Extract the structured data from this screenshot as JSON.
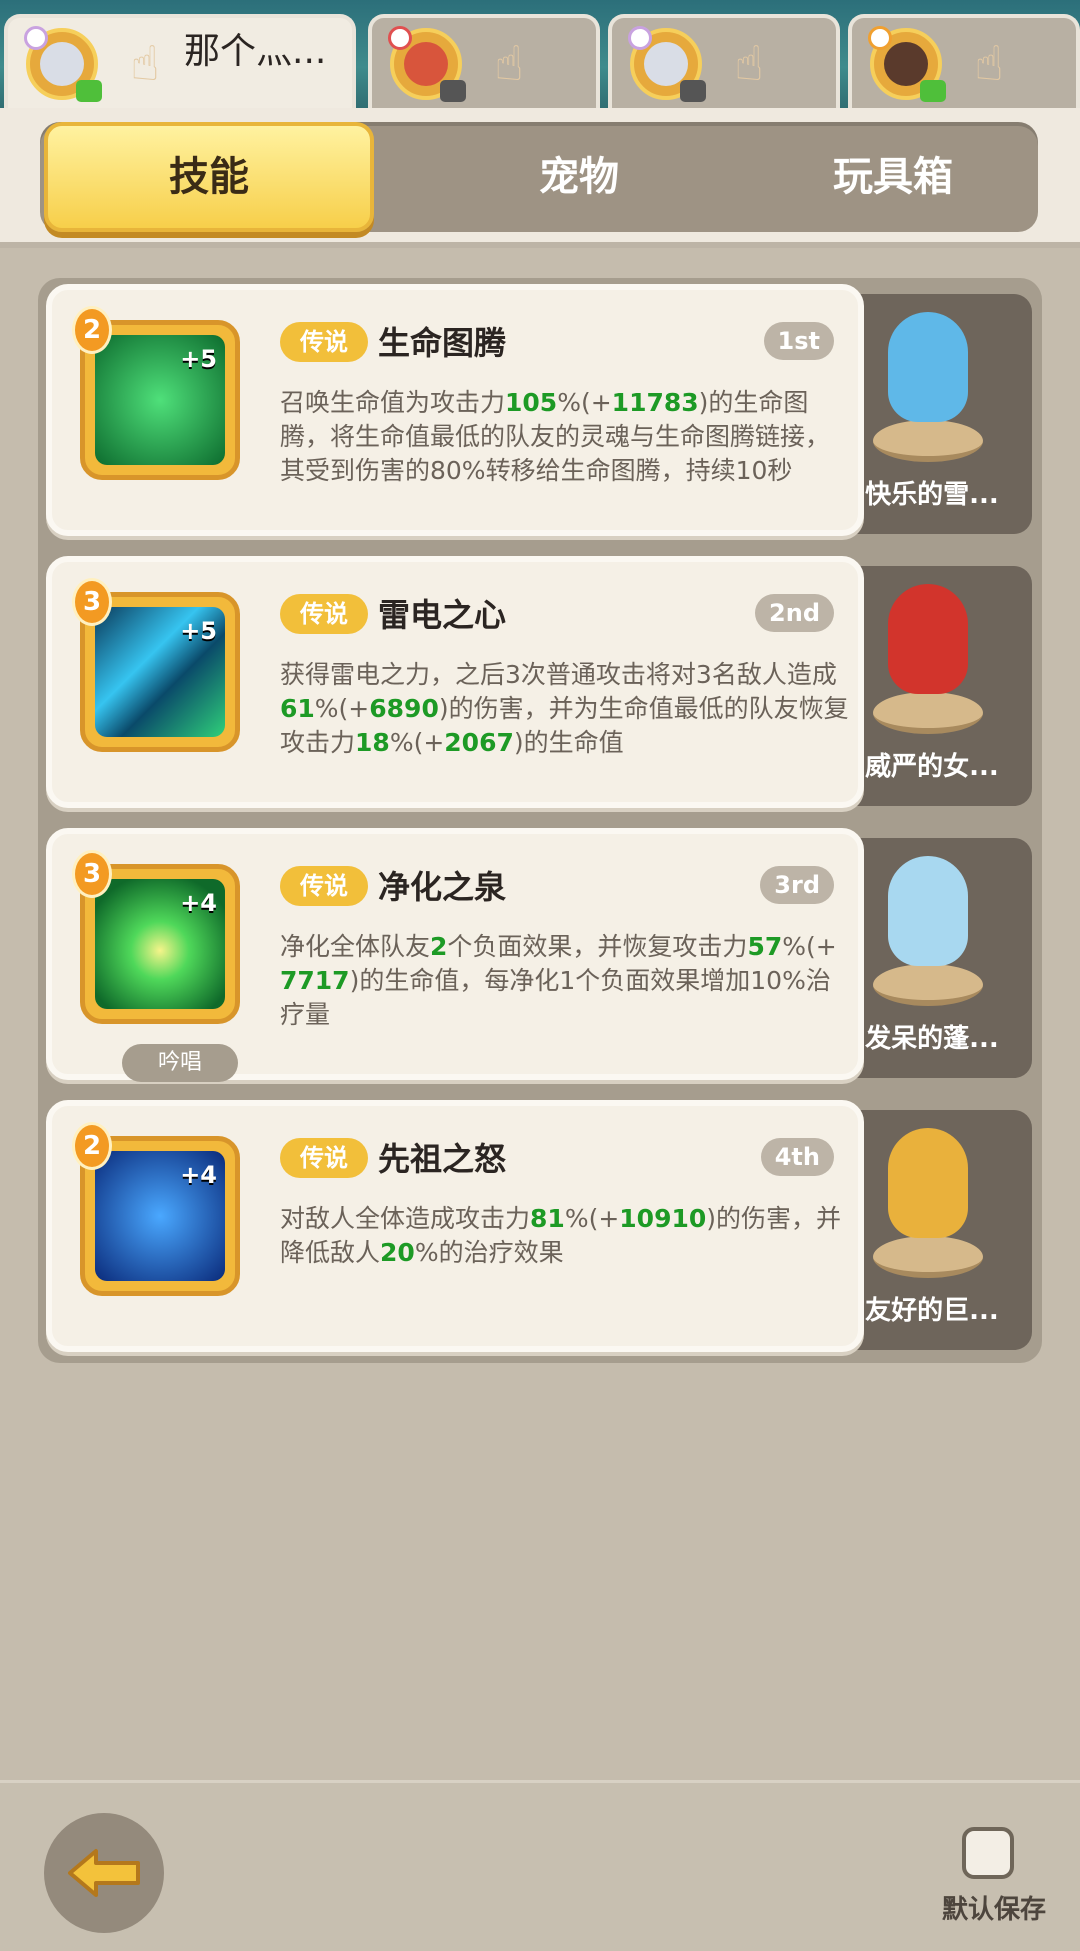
{
  "hero_tabs": [
    {
      "name": "那个灬...",
      "active": true
    },
    {
      "name": "",
      "active": false
    },
    {
      "name": "",
      "active": false
    },
    {
      "name": "",
      "active": false
    }
  ],
  "tabs": [
    {
      "label": "技能",
      "active": true
    },
    {
      "label": "宠物",
      "active": false
    },
    {
      "label": "玩具箱",
      "active": false
    }
  ],
  "skills": [
    {
      "level": "2",
      "bonus": "+5",
      "rarity": "传说",
      "name": "生命图腾",
      "rank": "1st",
      "desc_parts": [
        "召唤生命值为攻击力",
        "105",
        "%(+",
        "11783",
        ")的生命图腾，将生命值最低的队友的灵魂与生命图腾链接，其受到伤害的80%转移给生命图腾，持续10秒"
      ],
      "chant": "",
      "pet_name": "快乐的雪..."
    },
    {
      "level": "3",
      "bonus": "+5",
      "rarity": "传说",
      "name": "雷电之心",
      "rank": "2nd",
      "desc_parts": [
        "获得雷电之力，之后3次普通攻击将对3名敌人造成",
        "61",
        "%(+",
        "6890",
        ")的伤害，并为生命值最低的队友恢复攻击力",
        "18",
        "%(+",
        "2067",
        ")的生命值"
      ],
      "chant": "",
      "pet_name": "威严的女..."
    },
    {
      "level": "3",
      "bonus": "+4",
      "rarity": "传说",
      "name": "净化之泉",
      "rank": "3rd",
      "desc_parts": [
        "净化全体队友",
        "2",
        "个负面效果，并恢复攻击力",
        "57",
        "%(+",
        "7717",
        ")的生命值，每净化1个负面效果增加10%治疗量"
      ],
      "chant": "吟唱",
      "pet_name": "发呆的蓬..."
    },
    {
      "level": "2",
      "bonus": "+4",
      "rarity": "传说",
      "name": "先祖之怒",
      "rank": "4th",
      "desc_parts": [
        "对敌人全体造成攻击力",
        "81",
        "%(+",
        "10910",
        ")的伤害，并降低敌人",
        "20",
        "%的治疗效果"
      ],
      "chant": "",
      "pet_name": "友好的巨..."
    }
  ],
  "footer": {
    "save_label": "默认保存"
  },
  "colors": {
    "accent_yellow": "#f7cf4a",
    "value_green": "#1d9a25",
    "rarity_gold": "#f2bf3a"
  }
}
